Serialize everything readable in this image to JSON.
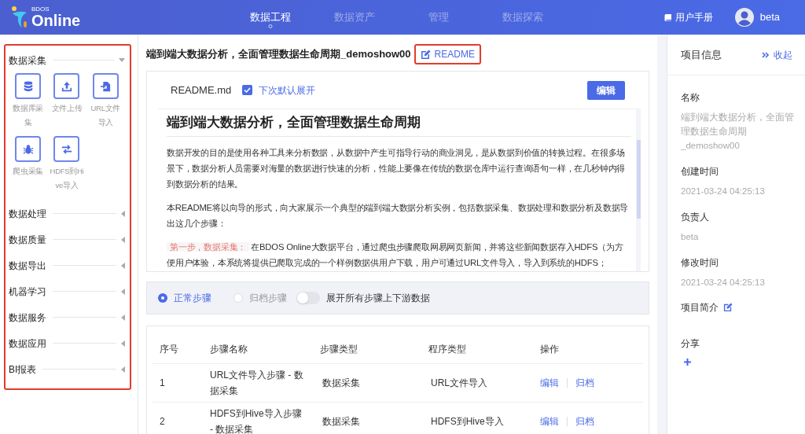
{
  "header": {
    "logo_small": "BDOS",
    "logo": "Online",
    "nav": [
      {
        "label": "数据工程",
        "selected": true
      },
      {
        "label": "数据资产",
        "selected": false
      },
      {
        "label": "管理",
        "selected": false
      },
      {
        "label": "数据探索",
        "selected": false
      }
    ],
    "manual": "用户手册",
    "user": "beta"
  },
  "sidebar": {
    "highlighted": true,
    "groups": [
      {
        "title": "数据采集",
        "expanded": true,
        "tiles": [
          {
            "label": "数据库采集",
            "kind": "database"
          },
          {
            "label": "文件上传",
            "kind": "upload"
          },
          {
            "label": "URL文件导入",
            "kind": "file-import"
          },
          {
            "label": "爬虫采集",
            "kind": "bug"
          },
          {
            "label": "HDFS到Hive导入",
            "kind": "transfer"
          }
        ]
      },
      {
        "title": "数据处理",
        "expanded": false
      },
      {
        "title": "数据质量",
        "expanded": false
      },
      {
        "title": "数据导出",
        "expanded": false
      },
      {
        "title": "机器学习",
        "expanded": false
      },
      {
        "title": "数据服务",
        "expanded": false
      },
      {
        "title": "数据应用",
        "expanded": false
      },
      {
        "title": "BI报表",
        "expanded": false
      }
    ]
  },
  "project": {
    "title": "端到端大数据分析，全面管理数据生命周期_demoshow00",
    "readme_button": {
      "label": "README",
      "highlighted": true
    }
  },
  "readme": {
    "filename": "README.md",
    "auto_expand": {
      "label": "下次默认展开",
      "checked": true
    },
    "edit_button": "编辑",
    "heading": "端到端大数据分析，全面管理数据生命周期",
    "paragraphs": [
      {
        "text": "数据开发的目的是使用各种工具来分析数据，从数据中产生可指导行动的商业洞见，是从数据到价值的转换过程。在很多场景下，数据分析人员需要对海量的数据进行快速的分析，性能上要像在传统的数据仓库中运行查询语句一样，在几秒钟内得到数据分析的结果。"
      },
      {
        "text": "本README将以向导的形式，向大家展示一个典型的端到端大数据分析实例，包括数据采集、数据处理和数据分析及数据导出这几个步骤："
      },
      {
        "tag": "第一步，数据采集：",
        "text": "在BDOS Online大数据平台，通过爬虫步骤爬取网易网页新闻，并将这些新闻数据存入HDFS（为方便用户体验，本系统将提供已爬取完成的一个样例数据供用户下载，用户可通过URL文件导入，导入到系统的HDFS；"
      }
    ]
  },
  "step_filter": {
    "options": [
      {
        "label": "正常步骤",
        "selected": true
      },
      {
        "label": "归档步骤",
        "selected": false
      }
    ],
    "toggle": {
      "label": "展开所有步骤上下游数据",
      "on": false
    }
  },
  "table": {
    "columns": [
      "序号",
      "步骤名称",
      "步骤类型",
      "程序类型",
      "操作"
    ],
    "rows": [
      {
        "index": "1",
        "name": "URL文件导入步骤 - 数据采集",
        "type": "数据采集",
        "program": "URL文件导入",
        "actions": [
          "编辑",
          "归档"
        ]
      },
      {
        "index": "2",
        "name": "HDFS到Hive导入步骤 - 数据采集",
        "type": "数据采集",
        "program": "HDFS到Hive导入",
        "actions": [
          "编辑",
          "归档"
        ]
      }
    ]
  },
  "info_panel": {
    "title": "项目信息",
    "collapse": "收起",
    "fields": [
      {
        "label": "名称",
        "value": "端到端大数据分析，全面管理数据生命周期_demoshow00"
      },
      {
        "label": "创建时间",
        "value": "2021-03-24 04:25:13"
      },
      {
        "label": "负责人",
        "value": "beta"
      },
      {
        "label": "修改时间",
        "value": "2021-03-24 04:25:13"
      }
    ],
    "intro": "项目简介",
    "share": "分享"
  }
}
